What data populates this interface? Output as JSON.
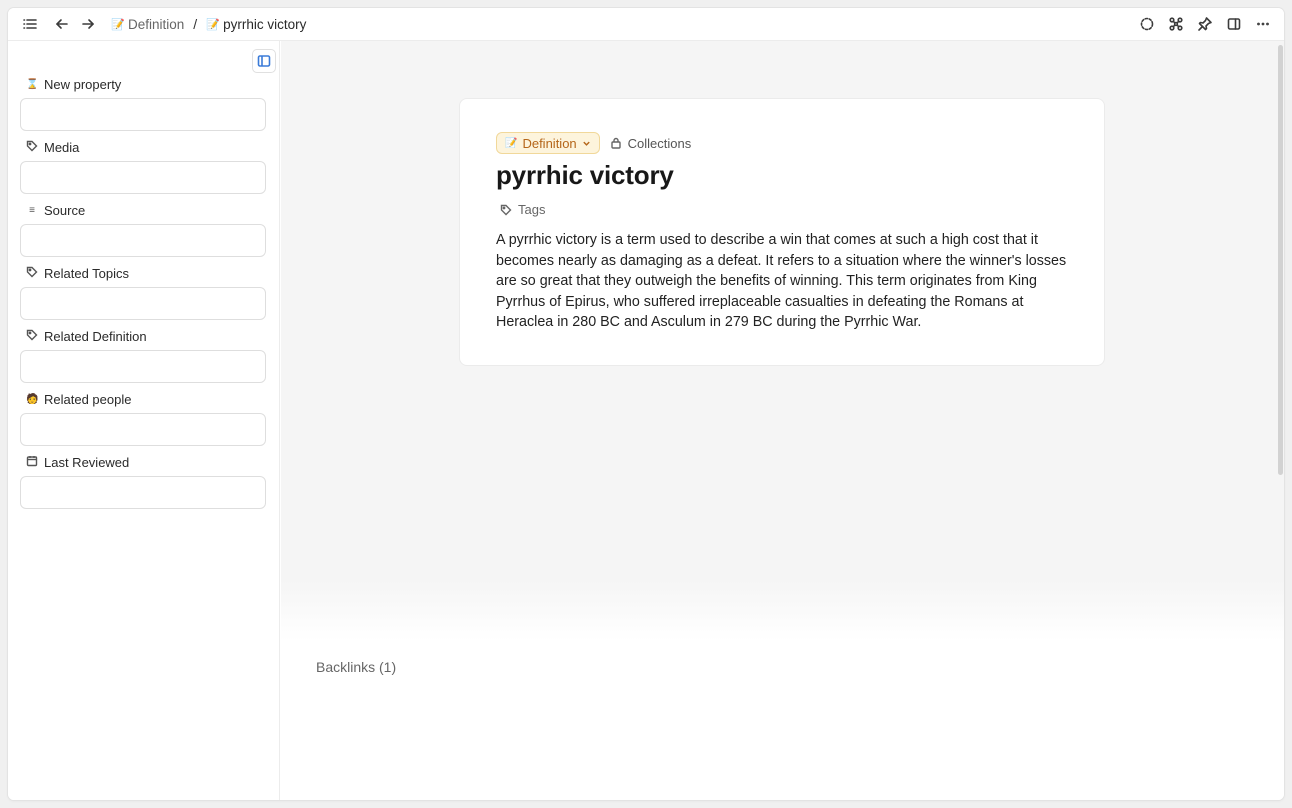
{
  "breadcrumb": {
    "parent_icon": "memo-emoji",
    "parent_emoji": "📝",
    "parent_label": "Definition",
    "separator": "/",
    "current_icon": "memo-emoji",
    "current_emoji": "📝",
    "current_label": "pyrrhic victory"
  },
  "toolbar": {
    "left_icons": [
      "list-icon",
      "arrow-left-icon",
      "arrow-right-icon"
    ],
    "right_icons": [
      "loading-dashed-circle-icon",
      "graph-nodes-icon",
      "pin-icon",
      "split-panel-icon",
      "more-icon"
    ]
  },
  "sidebar": {
    "toggle_icon": "sidebar-panel-icon",
    "properties": [
      {
        "label": "New property",
        "icon": "hourglass-emoji",
        "glyph": "⌛",
        "value": ""
      },
      {
        "label": "Media",
        "icon": "tag-icon",
        "glyph": "",
        "value": ""
      },
      {
        "label": "Source",
        "icon": "text-lines-icon",
        "glyph": "≡",
        "value": ""
      },
      {
        "label": "Related Topics",
        "icon": "tag-icon",
        "glyph": "",
        "value": ""
      },
      {
        "label": "Related Definition",
        "icon": "tag-icon",
        "glyph": "",
        "value": ""
      },
      {
        "label": "Related people",
        "icon": "person-emoji",
        "glyph": "🧑",
        "value": ""
      },
      {
        "label": "Last Reviewed",
        "icon": "calendar-icon",
        "glyph": "📅",
        "value": ""
      }
    ]
  },
  "document": {
    "type_label": "Definition",
    "type_emoji": "📝",
    "collections_label": "Collections",
    "title": "pyrrhic victory",
    "tags_label": "Tags",
    "body": "A pyrrhic victory is a term used to describe a win that comes at such a high cost that it becomes nearly as damaging as a defeat. It refers to a situation where the winner's losses are so great that they outweigh the benefits of winning. This term originates from King Pyrrhus of Epirus, who suffered irreplaceable casualties in defeating the Romans at Heraclea in 280 BC and Asculum in 279 BC during the Pyrrhic War."
  },
  "backlinks": {
    "label": "Backlinks (1)"
  },
  "colors": {
    "accent": "#3b7bd8",
    "type_pill_bg": "#fdf4dc",
    "type_pill_text": "#b5661a"
  }
}
